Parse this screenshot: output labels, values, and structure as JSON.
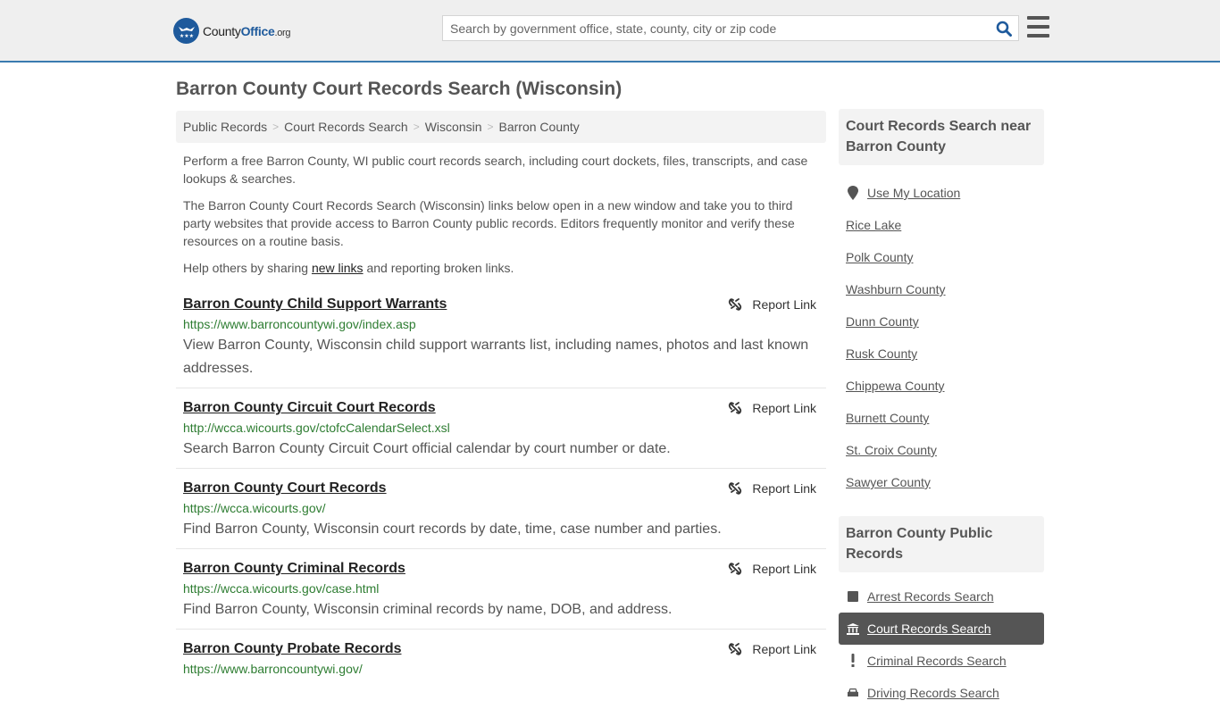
{
  "header": {
    "logo": {
      "name": "County",
      "name_bold": "Office",
      "tld": ".org"
    },
    "search": {
      "placeholder": "Search by government office, state, county, city or zip code",
      "value": ""
    },
    "colors": {
      "brand": "#1e5a9c",
      "accent_bar": "#3a7bb0",
      "url_green": "#2e7d32"
    }
  },
  "page": {
    "title": "Barron County Court Records Search (Wisconsin)",
    "breadcrumb": [
      "Public Records",
      "Court Records Search",
      "Wisconsin",
      "Barron County"
    ],
    "intro": {
      "p1": "Perform a free Barron County, WI public court records search, including court dockets, files, transcripts, and case lookups & searches.",
      "p2": "The Barron County Court Records Search (Wisconsin) links below open in a new window and take you to third party websites that provide access to Barron County public records. Editors frequently monitor and verify these resources on a routine basis.",
      "p3_before": "Help others by sharing ",
      "p3_link": "new links",
      "p3_after": " and reporting broken links."
    },
    "report_label": "Report Link",
    "results": [
      {
        "title": "Barron County Child Support Warrants",
        "url": "https://www.barroncountywi.gov/index.asp",
        "desc": "View Barron County, Wisconsin child support warrants list, including names, photos and last known addresses."
      },
      {
        "title": "Barron County Circuit Court Records",
        "url": "http://wcca.wicourts.gov/ctofcCalendarSelect.xsl",
        "desc": "Search Barron County Circuit Court official calendar by court number or date."
      },
      {
        "title": "Barron County Court Records",
        "url": "https://wcca.wicourts.gov/",
        "desc": "Find Barron County, Wisconsin court records by date, time, case number and parties."
      },
      {
        "title": "Barron County Criminal Records",
        "url": "https://wcca.wicourts.gov/case.html",
        "desc": "Find Barron County, Wisconsin criminal records by name, DOB, and address."
      },
      {
        "title": "Barron County Probate Records",
        "url": "https://www.barroncountywi.gov/",
        "desc": ""
      }
    ]
  },
  "sidebar": {
    "nearby": {
      "heading": "Court Records Search near Barron County",
      "use_location": "Use My Location",
      "items": [
        "Rice Lake",
        "Polk County",
        "Washburn County",
        "Dunn County",
        "Rusk County",
        "Chippewa County",
        "Burnett County",
        "St. Croix County",
        "Sawyer County"
      ]
    },
    "public_records": {
      "heading": "Barron County Public Records",
      "items": [
        {
          "label": "Arrest Records Search",
          "icon": "square-icon",
          "active": false
        },
        {
          "label": "Court Records Search",
          "icon": "courthouse-icon",
          "active": true
        },
        {
          "label": "Criminal Records Search",
          "icon": "exclamation-icon",
          "active": false
        },
        {
          "label": "Driving Records Search",
          "icon": "car-icon",
          "active": false
        }
      ]
    }
  }
}
